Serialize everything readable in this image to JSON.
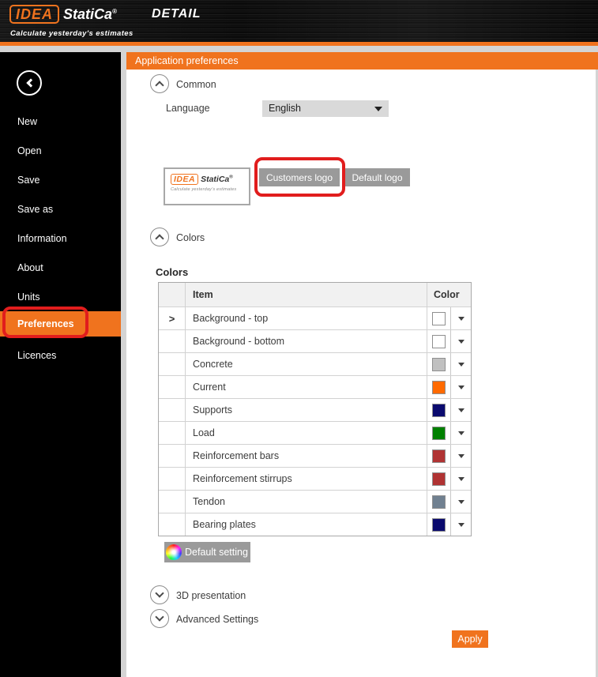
{
  "header": {
    "logo_idea": "IDEA",
    "logo_statica": "StatiCa",
    "logo_reg": "®",
    "product": "DETAIL",
    "tagline": "Calculate yesterday's estimates"
  },
  "sidebar": {
    "items": [
      {
        "label": "New",
        "active": false
      },
      {
        "label": "Open",
        "active": false
      },
      {
        "label": "Save",
        "active": false
      },
      {
        "label": "Save as",
        "active": false
      },
      {
        "label": "Information",
        "active": false
      },
      {
        "label": "About",
        "active": false
      },
      {
        "label": "Units",
        "active": false
      },
      {
        "label": "Preferences",
        "active": true
      },
      {
        "label": "Licences",
        "active": false
      }
    ]
  },
  "page": {
    "title": "Application preferences"
  },
  "sections": {
    "common": {
      "label": "Common",
      "expanded": true
    },
    "colors": {
      "label": "Colors",
      "expanded": true
    },
    "presentation3d": {
      "label": "3D presentation",
      "expanded": false
    },
    "advanced": {
      "label": "Advanced Settings",
      "expanded": false
    }
  },
  "common": {
    "language_label": "Language",
    "language_value": "English",
    "logo_preview": {
      "idea": "IDEA",
      "statica": "StatiCa",
      "reg": "®",
      "tagline": "Calculate yesterday's estimates"
    },
    "logo_buttons": [
      {
        "label": "Customers logo",
        "annotated": true
      },
      {
        "label": "Default logo",
        "annotated": false
      }
    ]
  },
  "colors": {
    "heading": "Colors",
    "table": {
      "columns": [
        "",
        "Item",
        "Color"
      ],
      "rows": [
        {
          "item": "Background - top",
          "color": "#ffffff",
          "selected": true
        },
        {
          "item": "Background - bottom",
          "color": "#ffffff",
          "selected": false
        },
        {
          "item": "Concrete",
          "color": "#c0c0c0",
          "selected": false
        },
        {
          "item": "Current",
          "color": "#ff6a00",
          "selected": false
        },
        {
          "item": "Supports",
          "color": "#0a0a6e",
          "selected": false
        },
        {
          "item": "Load",
          "color": "#008000",
          "selected": false
        },
        {
          "item": "Reinforcement bars",
          "color": "#b03333",
          "selected": false
        },
        {
          "item": "Reinforcement stirrups",
          "color": "#b03333",
          "selected": false
        },
        {
          "item": "Tendon",
          "color": "#708090",
          "selected": false
        },
        {
          "item": "Bearing plates",
          "color": "#0a0a6e",
          "selected": false
        }
      ]
    },
    "default_setting_label": "Default setting"
  },
  "footer": {
    "apply_label": "Apply"
  },
  "icons": {
    "back": "chevron-left-circle",
    "collapse": "chevron-up-circle",
    "expand": "chevron-down-circle",
    "dropdown": "triangle-down",
    "row_selector": "chevron-right",
    "default_setting": "color-wheel"
  },
  "accent_colors": {
    "orange": "#f0731e",
    "annotation_red": "#e11d1d",
    "button_gray": "#9a9a9a",
    "dropdown_gray": "#d9d9d9",
    "strip_gray": "#d4d4d4"
  }
}
